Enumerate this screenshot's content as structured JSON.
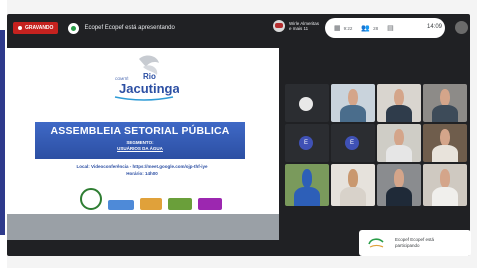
{
  "meeting": {
    "recording_label": "GRAVANDO",
    "presenter_text": "Ecopef Ecopef está apresentando",
    "attendee_text": "Wirle Almeritas\ne mais 11",
    "time": "14:09",
    "toolbar_nums": [
      "9:22",
      "28"
    ]
  },
  "slide": {
    "logo_small": "COMITÊ",
    "logo_main": "Rio",
    "logo_name": "Jacutinga",
    "title": "ASSEMBLEIA SETORIAL PÚBLICA",
    "segment_label": "SEGMENTO:",
    "segment_value": "USUÁRIOS DA ÁGUA",
    "location": "Local: Videoconferência - https://meet.google.com/ojp-thf-iye",
    "time": "Horário: 14h00"
  },
  "participants": {
    "avatar_initial": "E"
  },
  "toast": {
    "text": "Ecopef Ecopef está\nparticipando"
  },
  "colors": {
    "recording": "#c5221f",
    "banner": "#2c4fa3",
    "meet_bg": "#202124"
  }
}
